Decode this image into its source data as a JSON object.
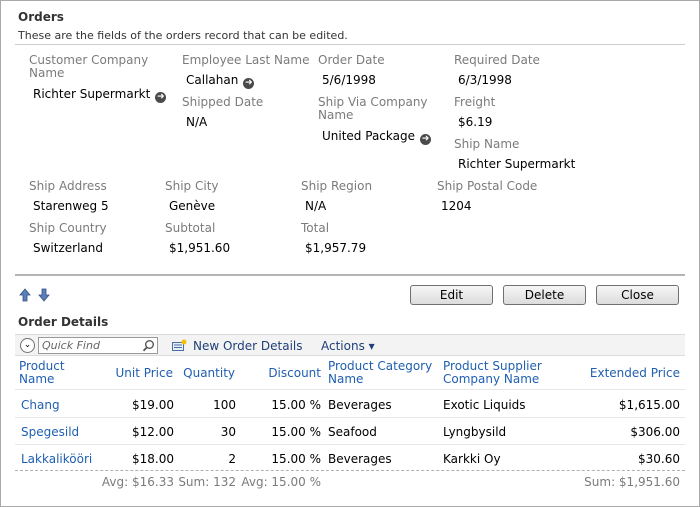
{
  "form": {
    "title": "Orders",
    "description": "These are the fields of the orders record that can be edited.",
    "fields": {
      "customer_company_name": {
        "label_line1": "Customer Company",
        "label_line2": "Name",
        "value": "Richter Supermarkt"
      },
      "employee_last_name": {
        "label": "Employee Last Name",
        "value": "Callahan"
      },
      "order_date": {
        "label": "Order Date",
        "value": "5/6/1998"
      },
      "required_date": {
        "label": "Required Date",
        "value": "6/3/1998"
      },
      "shipped_date": {
        "label": "Shipped Date",
        "value": "N/A"
      },
      "ship_via_company_name": {
        "label_line1": "Ship Via Company",
        "label_line2": "Name",
        "value": "United Package"
      },
      "freight": {
        "label": "Freight",
        "value": "$6.19"
      },
      "ship_name": {
        "label": "Ship Name",
        "value": "Richter Supermarkt"
      },
      "ship_address": {
        "label": "Ship Address",
        "value": "Starenweg 5"
      },
      "ship_city": {
        "label": "Ship City",
        "value": "Genève"
      },
      "ship_region": {
        "label": "Ship Region",
        "value": "N/A"
      },
      "ship_postal_code": {
        "label": "Ship Postal Code",
        "value": "1204"
      },
      "ship_country": {
        "label": "Ship Country",
        "value": "Switzerland"
      },
      "subtotal": {
        "label": "Subtotal",
        "value": "$1,951.60"
      },
      "total": {
        "label": "Total",
        "value": "$1,957.79"
      }
    },
    "lookup_icon": "arrow-circle-right-icon"
  },
  "actions_bar": {
    "nav_up_icon": "arrow-up-icon",
    "nav_down_icon": "arrow-down-icon",
    "edit_label": "Edit",
    "delete_label": "Delete",
    "close_label": "Close"
  },
  "details": {
    "title": "Order Details",
    "toolbar": {
      "view_selector_icon": "chevron-down-icon",
      "quick_find_placeholder": "Quick Find",
      "search_icon": "search-icon",
      "new_label": "New Order Details",
      "actions_label": "Actions ▾"
    },
    "columns": [
      {
        "line1": "Product",
        "line2": "Name"
      },
      {
        "line1": "Unit Price",
        "line2": ""
      },
      {
        "line1": "Quantity",
        "line2": ""
      },
      {
        "line1": "Discount",
        "line2": ""
      },
      {
        "line1": "Product Category",
        "line2": "Name"
      },
      {
        "line1": "Product Supplier",
        "line2": "Company Name"
      },
      {
        "line1": "Extended Price",
        "line2": ""
      }
    ],
    "rows": [
      {
        "product": "Chang",
        "unit_price": "$19.00",
        "quantity": "100",
        "discount": "15.00 %",
        "category": "Beverages",
        "supplier": "Exotic Liquids",
        "extended": "$1,615.00"
      },
      {
        "product": "Spegesild",
        "unit_price": "$12.00",
        "quantity": "30",
        "discount": "15.00 %",
        "category": "Seafood",
        "supplier": "Lyngbysild",
        "extended": "$306.00"
      },
      {
        "product": "Lakkalikööri",
        "unit_price": "$18.00",
        "quantity": "2",
        "discount": "15.00 %",
        "category": "Beverages",
        "supplier": "Karkki Oy",
        "extended": "$30.60"
      }
    ],
    "footer": {
      "avg_unit_price": "Avg: $16.33",
      "sum_quantity": "Sum: 132",
      "avg_discount": "Avg: 15.00 %",
      "sum_extended": "Sum: $1,951.60"
    }
  }
}
